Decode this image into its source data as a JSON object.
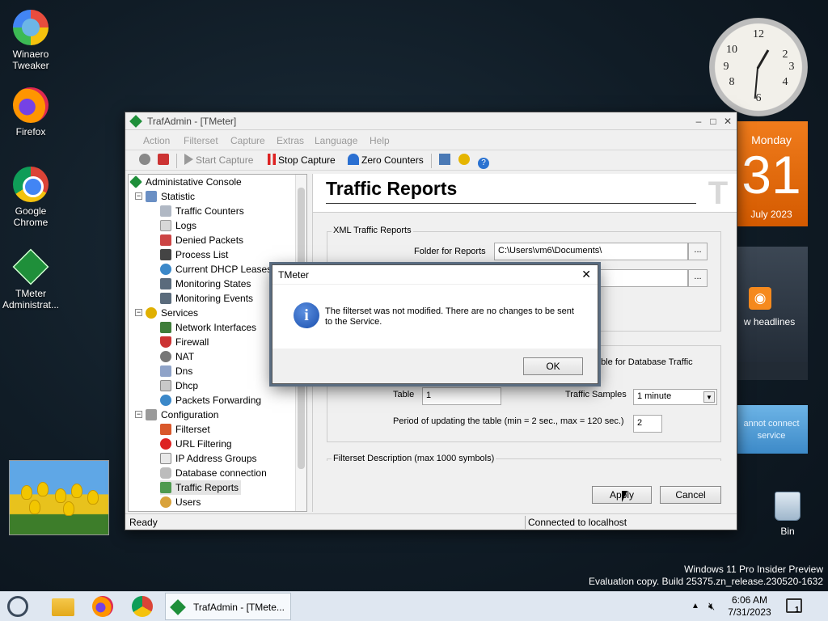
{
  "desktop": {
    "icons": [
      {
        "label": "Winaero Tweaker",
        "icon": "winaero-tweaker-icon"
      },
      {
        "label": "Firefox",
        "icon": "firefox-icon"
      },
      {
        "label": "Google Chrome",
        "icon": "chrome-icon"
      },
      {
        "label": "TMeter Administrat...",
        "icon": "tmeter-icon"
      }
    ],
    "recycle_bin": "Bin",
    "watermark_line1": "Windows 11 Pro Insider Preview",
    "watermark_line2": "Evaluation copy. Build 25375.zn_release.230520-1632"
  },
  "gadgets": {
    "calendar": {
      "day": "Monday",
      "date": "31",
      "month_year": "July 2023"
    },
    "feed": {
      "text": "w headlines"
    },
    "weather": {
      "text": "annot connect service"
    }
  },
  "window": {
    "title": "TrafAdmin - [TMeter]",
    "menu": [
      "Action",
      "Filterset",
      "Capture",
      "Extras",
      "Language",
      "Help"
    ],
    "toolbar": {
      "start": "Start Capture",
      "stop": "Stop Capture",
      "zero": "Zero Counters"
    },
    "tree": {
      "root": "Administative Console",
      "statistic": "Statistic",
      "statistic_items": [
        "Traffic Counters",
        "Logs",
        "Denied Packets",
        "Process List",
        "Current DHCP Leases",
        "Monitoring States",
        "Monitoring Events"
      ],
      "services": "Services",
      "services_items": [
        "Network Interfaces",
        "Firewall",
        "NAT",
        "Dns",
        "Dhcp",
        "Packets Forwarding"
      ],
      "configuration": "Configuration",
      "configuration_items": [
        "Filterset",
        "URL Filtering",
        "IP Address Groups",
        "Database connection",
        "Traffic Reports",
        "Users"
      ],
      "selected": "Traffic Reports"
    },
    "content": {
      "heading": "Traffic Reports",
      "xml_group": "XML Traffic Reports",
      "folder_label": "Folder for Reports",
      "folder_value": "C:\\Users\\vm6\\Documents\\",
      "browse": "...",
      "db_fragment": "able for Database Traffic",
      "table_label": "Table",
      "table_value": "1",
      "samples_label": "Traffic Samples",
      "samples_value": "1 minute",
      "period_label": "Period of updating the table (min = 2 sec., max = 120 sec.)",
      "period_value": "2",
      "desc_group": "Filterset Description (max 1000 symbols)",
      "apply": "Apply",
      "cancel": "Cancel"
    },
    "status": {
      "left": "Ready",
      "right": "Connected to localhost"
    }
  },
  "dialog": {
    "title": "TMeter",
    "message": "The filterset was not modified. There are no changes to be sent to the Service.",
    "ok": "OK"
  },
  "taskbar": {
    "active_app": "TrafAdmin - [TMete...",
    "time": "6:06 AM",
    "date": "7/31/2023",
    "notification_count": "1"
  }
}
